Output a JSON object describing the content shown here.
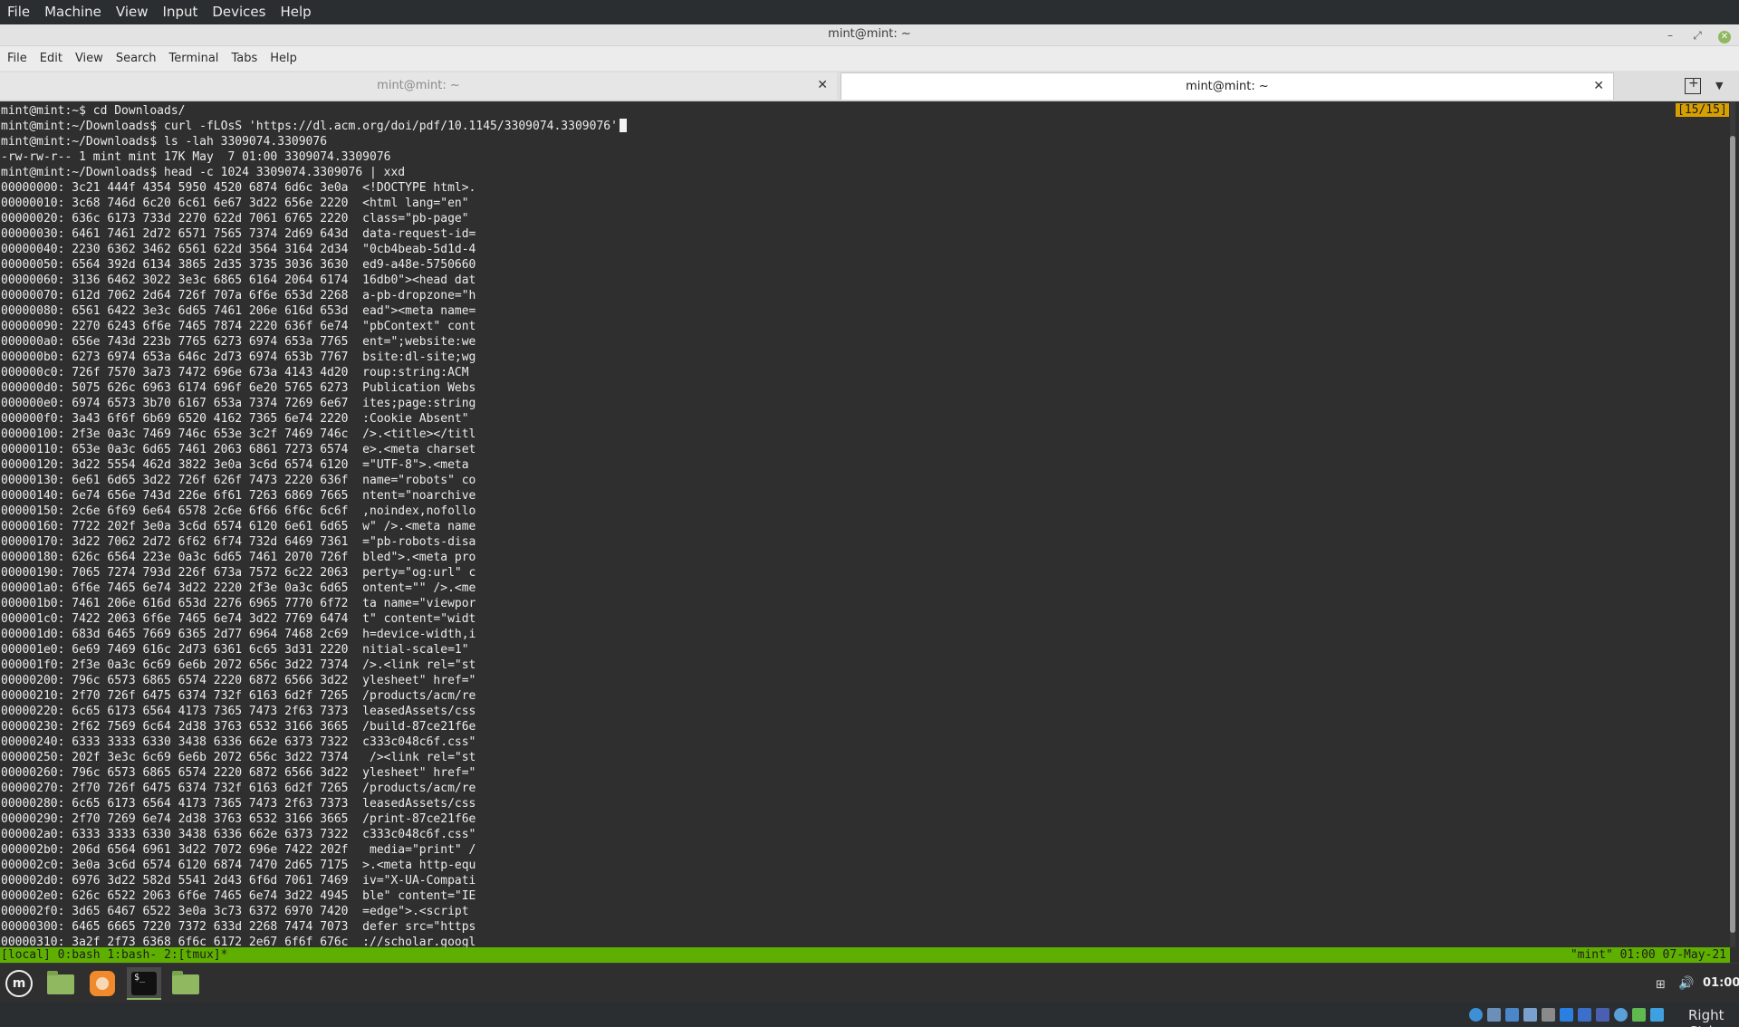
{
  "vbox": {
    "menu": [
      "File",
      "Machine",
      "View",
      "Input",
      "Devices",
      "Help"
    ],
    "host_key": "Right Ctrl"
  },
  "window": {
    "title": "mint@mint: ~",
    "min_glyph": "–",
    "max_glyph": "⤢",
    "close_glyph": "✕"
  },
  "terminal_menu": [
    "File",
    "Edit",
    "View",
    "Search",
    "Terminal",
    "Tabs",
    "Help"
  ],
  "tabs": [
    {
      "label": "mint@mint: ~",
      "close": "✕",
      "active": false
    },
    {
      "label": "mint@mint: ~",
      "close": "✕",
      "active": true
    }
  ],
  "tab_menu_glyph": "▼",
  "terminal": {
    "position_indicator": "[15/15]",
    "lines": [
      "mint@mint:~$ cd Downloads/",
      "mint@mint:~/Downloads$ curl -fLOsS 'https://dl.acm.org/doi/pdf/10.1145/3309074.3309076'",
      "mint@mint:~/Downloads$ ls -lah 3309074.3309076",
      "-rw-rw-r-- 1 mint mint 17K May  7 01:00 3309074.3309076",
      "mint@mint:~/Downloads$ head -c 1024 3309074.3309076 | xxd",
      "00000000: 3c21 444f 4354 5950 4520 6874 6d6c 3e0a  <!DOCTYPE html>.",
      "00000010: 3c68 746d 6c20 6c61 6e67 3d22 656e 2220  <html lang=\"en\" ",
      "00000020: 636c 6173 733d 2270 622d 7061 6765 2220  class=\"pb-page\" ",
      "00000030: 6461 7461 2d72 6571 7565 7374 2d69 643d  data-request-id=",
      "00000040: 2230 6362 3462 6561 622d 3564 3164 2d34  \"0cb4beab-5d1d-4",
      "00000050: 6564 392d 6134 3865 2d35 3735 3036 3630  ed9-a48e-5750660",
      "00000060: 3136 6462 3022 3e3c 6865 6164 2064 6174  16db0\"><head dat",
      "00000070: 612d 7062 2d64 726f 707a 6f6e 653d 2268  a-pb-dropzone=\"h",
      "00000080: 6561 6422 3e3c 6d65 7461 206e 616d 653d  ead\"><meta name=",
      "00000090: 2270 6243 6f6e 7465 7874 2220 636f 6e74  \"pbContext\" cont",
      "000000a0: 656e 743d 223b 7765 6273 6974 653a 7765  ent=\";website:we",
      "000000b0: 6273 6974 653a 646c 2d73 6974 653b 7767  bsite:dl-site;wg",
      "000000c0: 726f 7570 3a73 7472 696e 673a 4143 4d20  roup:string:ACM ",
      "000000d0: 5075 626c 6963 6174 696f 6e20 5765 6273  Publication Webs",
      "000000e0: 6974 6573 3b70 6167 653a 7374 7269 6e67  ites;page:string",
      "000000f0: 3a43 6f6f 6b69 6520 4162 7365 6e74 2220  :Cookie Absent\" ",
      "00000100: 2f3e 0a3c 7469 746c 653e 3c2f 7469 746c  />.<title></titl",
      "00000110: 653e 0a3c 6d65 7461 2063 6861 7273 6574  e>.<meta charset",
      "00000120: 3d22 5554 462d 3822 3e0a 3c6d 6574 6120  =\"UTF-8\">.<meta ",
      "00000130: 6e61 6d65 3d22 726f 626f 7473 2220 636f  name=\"robots\" co",
      "00000140: 6e74 656e 743d 226e 6f61 7263 6869 7665  ntent=\"noarchive",
      "00000150: 2c6e 6f69 6e64 6578 2c6e 6f66 6f6c 6c6f  ,noindex,nofollo",
      "00000160: 7722 202f 3e0a 3c6d 6574 6120 6e61 6d65  w\" />.<meta name",
      "00000170: 3d22 7062 2d72 6f62 6f74 732d 6469 7361  =\"pb-robots-disa",
      "00000180: 626c 6564 223e 0a3c 6d65 7461 2070 726f  bled\">.<meta pro",
      "00000190: 7065 7274 793d 226f 673a 7572 6c22 2063  perty=\"og:url\" c",
      "000001a0: 6f6e 7465 6e74 3d22 2220 2f3e 0a3c 6d65  ontent=\"\" />.<me",
      "000001b0: 7461 206e 616d 653d 2276 6965 7770 6f72  ta name=\"viewpor",
      "000001c0: 7422 2063 6f6e 7465 6e74 3d22 7769 6474  t\" content=\"widt",
      "000001d0: 683d 6465 7669 6365 2d77 6964 7468 2c69  h=device-width,i",
      "000001e0: 6e69 7469 616c 2d73 6361 6c65 3d31 2220  nitial-scale=1\" ",
      "000001f0: 2f3e 0a3c 6c69 6e6b 2072 656c 3d22 7374  />.<link rel=\"st",
      "00000200: 796c 6573 6865 6574 2220 6872 6566 3d22  ylesheet\" href=\"",
      "00000210: 2f70 726f 6475 6374 732f 6163 6d2f 7265  /products/acm/re",
      "00000220: 6c65 6173 6564 4173 7365 7473 2f63 7373  leasedAssets/css",
      "00000230: 2f62 7569 6c64 2d38 3763 6532 3166 3665  /build-87ce21f6e",
      "00000240: 6333 3333 6330 3438 6336 662e 6373 7322  c333c048c6f.css\"",
      "00000250: 202f 3e3c 6c69 6e6b 2072 656c 3d22 7374   /><link rel=\"st",
      "00000260: 796c 6573 6865 6574 2220 6872 6566 3d22  ylesheet\" href=\"",
      "00000270: 2f70 726f 6475 6374 732f 6163 6d2f 7265  /products/acm/re",
      "00000280: 6c65 6173 6564 4173 7365 7473 2f63 7373  leasedAssets/css",
      "00000290: 2f70 7269 6e74 2d38 3763 6532 3166 3665  /print-87ce21f6e",
      "000002a0: 6333 3333 6330 3438 6336 662e 6373 7322  c333c048c6f.css\"",
      "000002b0: 206d 6564 6961 3d22 7072 696e 7422 202f   media=\"print\" /",
      "000002c0: 3e0a 3c6d 6574 6120 6874 7470 2d65 7175  >.<meta http-equ",
      "000002d0: 6976 3d22 582d 5541 2d43 6f6d 7061 7469  iv=\"X-UA-Compati",
      "000002e0: 626c 6522 2063 6f6e 7465 6e74 3d22 4945  ble\" content=\"IE",
      "000002f0: 3d65 6467 6522 3e0a 3c73 6372 6970 7420  =edge\">.<script ",
      "00000300: 6465 6665 7220 7372 633d 2268 7474 7073  defer src=\"https",
      "00000310: 3a2f 2f73 6368 6f6c 6172 2e67 6f6f 676c  ://scholar.googl"
    ]
  },
  "tmux": {
    "left": "[local] 0:bash  1:bash- 2:[tmux]*",
    "right": "\"mint\" 01:00 07-May-21"
  },
  "panel": {
    "menu_glyph": "m",
    "terminal_glyph": "$_",
    "network_glyph": "⊞",
    "volume_glyph": "🔊",
    "clock": "01:00"
  },
  "colors": {
    "tmux_status": "#5faf00",
    "position_indicator": "#d7a000",
    "mint_green": "#8fb861"
  }
}
